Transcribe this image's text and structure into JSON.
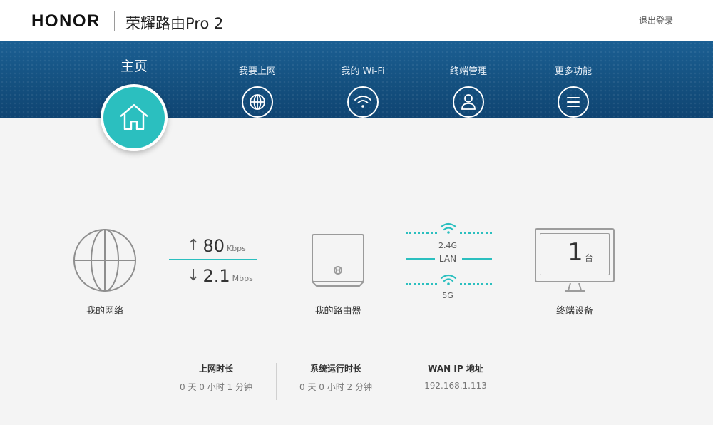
{
  "header": {
    "brand": "HONOR",
    "product_name": "荣耀路由Pro 2",
    "logout": "退出登录"
  },
  "nav": {
    "home": "主页",
    "items": [
      {
        "label": "我要上网",
        "icon": "globe-icon"
      },
      {
        "label": "我的 Wi-Fi",
        "icon": "wifi-icon"
      },
      {
        "label": "终端管理",
        "icon": "user-icon"
      },
      {
        "label": "更多功能",
        "icon": "menu-icon"
      }
    ]
  },
  "status": {
    "network_label": "我的网络",
    "upload": {
      "arrow": "↑",
      "value": "80",
      "unit": "Kbps"
    },
    "download": {
      "arrow": "↓",
      "value": "2.1",
      "unit": "Mbps"
    },
    "router_label": "我的路由器",
    "bands": {
      "band_24": "2.4G",
      "lan": "LAN",
      "band_5": "5G"
    },
    "devices": {
      "count": "1",
      "unit": "台",
      "label": "终端设备"
    }
  },
  "stats": [
    {
      "title": "上网时长",
      "value": "0 天 0 小时 1 分钟"
    },
    {
      "title": "系统运行时长",
      "value": "0 天 0 小时 2 分钟"
    },
    {
      "title": "WAN IP 地址",
      "value": "192.168.1.113"
    }
  ],
  "colors": {
    "accent": "#2bbfbf",
    "nav_band": "#14507f",
    "background": "#f4f4f4"
  }
}
